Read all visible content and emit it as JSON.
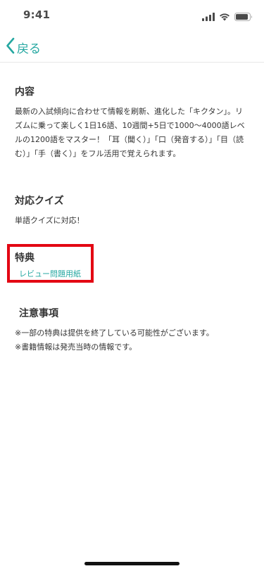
{
  "status_bar": {
    "time": "9:41"
  },
  "nav": {
    "back_label": "戻る",
    "accent_color": "#25a7a1"
  },
  "content": {
    "heading": "内容",
    "body": "最新の入試傾向に合わせて情報を刷新、進化した「キクタン」。リズムに乗って楽しく1日16語、10週間+5日で1000〜4000語レベルの1200語をマスター！「耳（聞く）」「口（発音する）」「目（読む）」「手（書く）」をフル活用で覚えられます。"
  },
  "quiz": {
    "heading": "対応クイズ",
    "body": "単語クイズに対応！"
  },
  "benefit": {
    "heading": "特典",
    "link_label": "レビュー問題用紙",
    "highlight_color": "#e30613"
  },
  "notes": {
    "heading": "注意事項",
    "lines": [
      "※一部の特典は提供を終了している可能性がございます。",
      "※書籍情報は発売当時の情報です。"
    ]
  }
}
